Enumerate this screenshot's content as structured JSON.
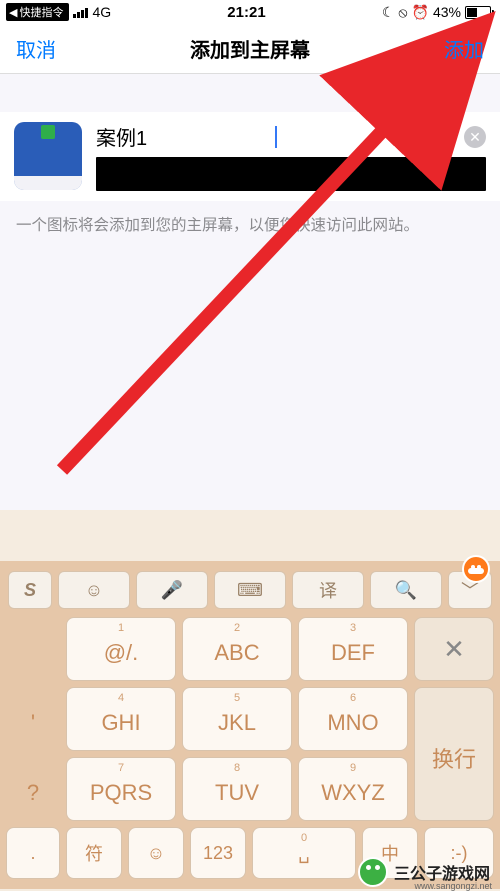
{
  "status": {
    "back_app": "快捷指令",
    "carrier": "4G",
    "time": "21:21",
    "moon": "☾",
    "dnd": "⦸",
    "alarm": "⏰",
    "battery_pct": "43%"
  },
  "nav": {
    "cancel": "取消",
    "title": "添加到主屏幕",
    "add": "添加"
  },
  "entry": {
    "name_value": "案例1",
    "clear_glyph": "✕"
  },
  "hint": "一个图标将会添加到您的主屏幕，以便您快速访问此网站。",
  "keyboard": {
    "toolbar": {
      "logo": "S",
      "emoji": "☺",
      "mic": "🎤",
      "kbd": "⌨",
      "trans": "译",
      "search": "🔍",
      "collapse": "﹀"
    },
    "rows": [
      {
        "side_left": " ",
        "keys": [
          {
            "num": "1",
            "main": "@/."
          },
          {
            "num": "2",
            "main": "ABC"
          },
          {
            "num": "3",
            "main": "DEF"
          }
        ],
        "action": "✕",
        "action_name": "backspace"
      },
      {
        "side_left": "'",
        "keys": [
          {
            "num": "4",
            "main": "GHI"
          },
          {
            "num": "5",
            "main": "JKL"
          },
          {
            "num": "6",
            "main": "MNO"
          }
        ],
        "action": "换行",
        "action_name": "return"
      },
      {
        "side_left": "?",
        "keys": [
          {
            "num": "7",
            "main": "PQRS"
          },
          {
            "num": "8",
            "main": "TUV"
          },
          {
            "num": "9",
            "main": "WXYZ"
          }
        ],
        "action": "",
        "action_name": ""
      }
    ],
    "row4_side": ".",
    "bottom": {
      "sym": "符",
      "emoji_btn": "☺",
      "num": "123",
      "space_num": "0",
      "space": "␣",
      "zh": "中",
      "more": ":-)"
    }
  },
  "watermark": {
    "text": "三公子游戏网",
    "sub": "www.sangongzi.net"
  }
}
